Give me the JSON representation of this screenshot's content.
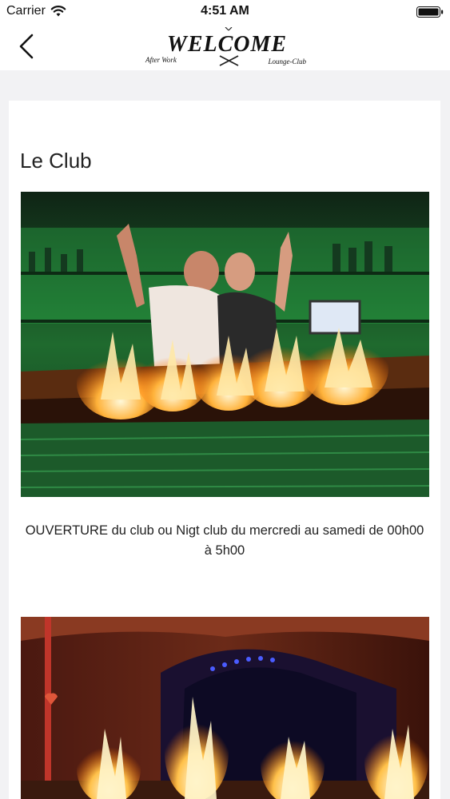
{
  "status_bar": {
    "carrier": "Carrier",
    "time": "4:51 AM"
  },
  "nav": {
    "logo_title": "WELCOME",
    "logo_left": "After Work",
    "logo_right": "Lounge-Club"
  },
  "content": {
    "section_title": "Le Club",
    "description": "OUVERTURE du club ou Nigt club du mercredi au samedi de 00h00 à 5h00"
  },
  "colors": {
    "background": "#f2f2f4",
    "card": "#ffffff",
    "text": "#222222"
  },
  "icons": {
    "back": "chevron-left-icon",
    "wifi": "wifi-icon",
    "battery": "battery-icon"
  }
}
